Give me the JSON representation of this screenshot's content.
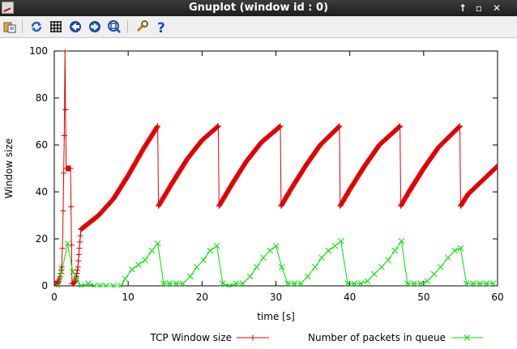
{
  "window": {
    "title": "Gnuplot (window id : 0)",
    "controls": {
      "maximize": "↑",
      "restore": "▫",
      "close": "✕"
    }
  },
  "toolbar": {
    "items": [
      "copy-to-clipboard",
      "replot",
      "toggle-grid",
      "previous-zoom",
      "next-zoom",
      "autoscale",
      "configure",
      "help"
    ]
  },
  "colors": {
    "tcp": "#e00000",
    "queue": "#00e000",
    "titlebar": "#2a2a2a"
  },
  "chart_data": {
    "type": "line",
    "title": "",
    "xlabel": "time [s]",
    "ylabel": "Window size",
    "xlim": [
      0,
      60
    ],
    "ylim": [
      0,
      100
    ],
    "xticks": [
      "0",
      "10",
      "20",
      "30",
      "40",
      "50",
      "60"
    ],
    "yticks": [
      "0",
      "20",
      "40",
      "60",
      "80",
      "100"
    ],
    "grid": false,
    "legend_position": "bottom",
    "series": [
      {
        "name": "TCP Window size",
        "color": "#e00000",
        "marker": "+",
        "points": [
          [
            0,
            1
          ],
          [
            0.2,
            1
          ],
          [
            0.4,
            1
          ],
          [
            0.6,
            2
          ],
          [
            0.8,
            4
          ],
          [
            1.0,
            8
          ],
          [
            1.1,
            16
          ],
          [
            1.2,
            32
          ],
          [
            1.35,
            64
          ],
          [
            1.45,
            100
          ],
          [
            1.6,
            50
          ],
          [
            2.0,
            50
          ],
          [
            2.2,
            50
          ],
          [
            2.4,
            1
          ],
          [
            2.6,
            1
          ],
          [
            2.8,
            2
          ],
          [
            3.0,
            4
          ],
          [
            3.2,
            8
          ],
          [
            3.4,
            16
          ],
          [
            3.6,
            24
          ],
          [
            4.0,
            25
          ],
          [
            6.0,
            30
          ],
          [
            8.0,
            37
          ],
          [
            10.0,
            47
          ],
          [
            12.0,
            58
          ],
          [
            14.0,
            68
          ],
          [
            14.1,
            34
          ],
          [
            16.0,
            44
          ],
          [
            18.0,
            54
          ],
          [
            20.0,
            62
          ],
          [
            22.2,
            68
          ],
          [
            22.3,
            34
          ],
          [
            24.0,
            43
          ],
          [
            26.0,
            53
          ],
          [
            28.0,
            61
          ],
          [
            30.6,
            68
          ],
          [
            30.7,
            34
          ],
          [
            32.0,
            41
          ],
          [
            34.0,
            51
          ],
          [
            36.0,
            60
          ],
          [
            38.6,
            68
          ],
          [
            38.7,
            34
          ],
          [
            40.0,
            41
          ],
          [
            42.0,
            51
          ],
          [
            44.0,
            60
          ],
          [
            46.8,
            68
          ],
          [
            46.9,
            34
          ],
          [
            48.0,
            40
          ],
          [
            50.0,
            50
          ],
          [
            52.0,
            59
          ],
          [
            54.9,
            68
          ],
          [
            55.0,
            34
          ],
          [
            56.0,
            39
          ],
          [
            58.0,
            45
          ],
          [
            60.0,
            51
          ]
        ]
      },
      {
        "name": "Number of packets in queue",
        "color": "#00e000",
        "marker": "x",
        "points": [
          [
            0.5,
            0
          ],
          [
            1.0,
            6
          ],
          [
            1.8,
            18
          ],
          [
            2.5,
            6
          ],
          [
            3.0,
            3
          ],
          [
            3.6,
            0
          ],
          [
            4.6,
            1
          ],
          [
            5.4,
            0
          ],
          [
            6.2,
            0
          ],
          [
            7.0,
            0
          ],
          [
            8.0,
            0
          ],
          [
            9.0,
            0
          ],
          [
            9.6,
            3
          ],
          [
            10.5,
            7
          ],
          [
            11.4,
            9
          ],
          [
            12.3,
            11
          ],
          [
            13.2,
            15
          ],
          [
            14.0,
            18
          ],
          [
            14.8,
            1
          ],
          [
            15.6,
            1
          ],
          [
            16.5,
            1
          ],
          [
            17.4,
            1
          ],
          [
            18.4,
            4
          ],
          [
            19.3,
            8
          ],
          [
            20.2,
            11
          ],
          [
            21.1,
            15
          ],
          [
            22.0,
            17
          ],
          [
            22.8,
            1
          ],
          [
            23.7,
            0
          ],
          [
            24.6,
            1
          ],
          [
            25.5,
            1
          ],
          [
            26.5,
            4
          ],
          [
            27.4,
            8
          ],
          [
            28.3,
            12
          ],
          [
            29.2,
            15
          ],
          [
            30.0,
            17
          ],
          [
            30.8,
            8
          ],
          [
            31.6,
            1
          ],
          [
            32.5,
            1
          ],
          [
            33.4,
            1
          ],
          [
            34.3,
            4
          ],
          [
            35.3,
            8
          ],
          [
            36.2,
            12
          ],
          [
            37.1,
            15
          ],
          [
            38.0,
            17
          ],
          [
            38.8,
            19
          ],
          [
            39.7,
            1
          ],
          [
            40.6,
            1
          ],
          [
            41.5,
            1
          ],
          [
            42.4,
            2
          ],
          [
            43.3,
            5
          ],
          [
            44.3,
            8
          ],
          [
            45.2,
            11
          ],
          [
            46.1,
            15
          ],
          [
            47.0,
            19
          ],
          [
            47.8,
            1
          ],
          [
            48.7,
            1
          ],
          [
            49.6,
            1
          ],
          [
            50.5,
            2
          ],
          [
            51.4,
            5
          ],
          [
            52.3,
            8
          ],
          [
            53.3,
            12
          ],
          [
            54.2,
            15
          ],
          [
            55.0,
            16
          ],
          [
            55.8,
            1
          ],
          [
            56.7,
            1
          ],
          [
            57.6,
            1
          ],
          [
            58.5,
            1
          ],
          [
            59.4,
            1
          ]
        ]
      }
    ]
  }
}
